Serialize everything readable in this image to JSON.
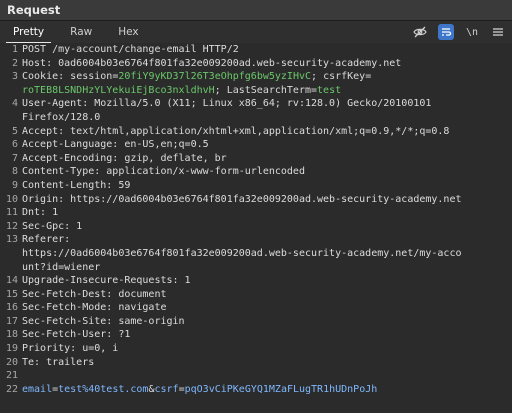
{
  "header": {
    "title": "Request"
  },
  "tabs": [
    {
      "label": "Pretty"
    },
    {
      "label": "Raw"
    },
    {
      "label": "Hex"
    }
  ],
  "toolbar": {
    "newline_toggle": "\\n"
  },
  "lines": {
    "l1": "POST /my-account/change-email HTTP/2",
    "l2": "Host: 0ad6004b03e6764f801fa32e009200ad.web-security-academy.net",
    "l3_prefix": "Cookie: ",
    "l3_session_name": "session",
    "l3_session_val": "20fiY9yKD37l26T3eOhpfg6bw5yzIHvC",
    "l3_csrf_name": "csrfKey",
    "l3_csrf_val_1": "",
    "l3_csrf_val_2": "roTEB8LSNDHzYLYekuiEjBco3nxldhvH",
    "l3_lst_name": "LastSearchTerm",
    "l3_lst_val": "test",
    "l4a": "User-Agent: Mozilla/5.0 (X11; Linux x86_64; rv:128.0) Gecko/20100101",
    "l4b": "Firefox/128.0",
    "l5": "Accept: text/html,application/xhtml+xml,application/xml;q=0.9,*/*;q=0.8",
    "l6": "Accept-Language: en-US,en;q=0.5",
    "l7": "Accept-Encoding: gzip, deflate, br",
    "l8": "Content-Type: application/x-www-form-urlencoded",
    "l9": "Content-Length: 59",
    "l10": "Origin: https://0ad6004b03e6764f801fa32e009200ad.web-security-academy.net",
    "l11": "Dnt: 1",
    "l12": "Sec-Gpc: 1",
    "l13a": "Referer:",
    "l13b": "https://0ad6004b03e6764f801fa32e009200ad.web-security-academy.net/my-acco",
    "l13c": "unt?id=wiener",
    "l14": "Upgrade-Insecure-Requests: 1",
    "l15": "Sec-Fetch-Dest: document",
    "l16": "Sec-Fetch-Mode: navigate",
    "l17": "Sec-Fetch-Site: same-origin",
    "l18": "Sec-Fetch-User: ?1",
    "l19": "Priority: u=0, i",
    "l20": "Te: trailers",
    "l21": "",
    "l22_email_name": "email",
    "l22_email_val": "test%40test.com",
    "l22_csrf_name": "csrf",
    "l22_csrf_val": "pqO3vCiPKeGYQ1MZaFLugTR1hUDnPoJh"
  },
  "line_numbers": [
    "1",
    "2",
    "3",
    "4",
    "5",
    "6",
    "7",
    "8",
    "9",
    "10",
    "11",
    "12",
    "13",
    "14",
    "15",
    "16",
    "17",
    "18",
    "19",
    "20",
    "21",
    "22"
  ]
}
